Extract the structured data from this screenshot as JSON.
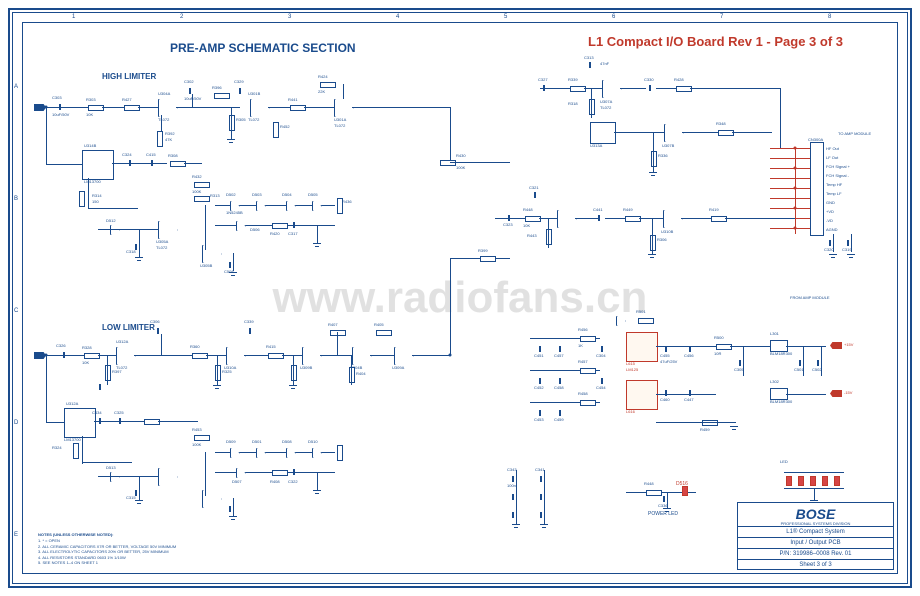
{
  "header": {
    "title": "L1 Compact I/O Board Rev 1 - Page 3 of 3",
    "section_main": "PRE-AMP SCHEMATIC SECTION",
    "section_high": "HIGH LIMITER",
    "section_low": "LOW LIMITER",
    "to_amp": "TO AMP MODULE",
    "from_amp": "FROM AMP MODULE",
    "power_led": "POWER LED",
    "watermark": "www.radiofans.cn"
  },
  "titleblock": {
    "brand": "BOSE",
    "brand_sub": "PROFESSIONAL SYSTEMS DIVISION",
    "product": "L1® Compact System",
    "board": "Input / Output PCB",
    "pn": "P/N: 319986–0008 Rev. 01",
    "sheet": "Sheet 3 of 3"
  },
  "grid": {
    "cols": [
      "1",
      "2",
      "3",
      "4",
      "5",
      "6",
      "7",
      "8"
    ],
    "rows": [
      "A",
      "B",
      "C",
      "D",
      "E"
    ]
  },
  "parts": {
    "opamp": "TL072",
    "comparator": "LM13700",
    "thermal": "LM125",
    "sense_ic": "L615",
    "sense_ic2": "L616",
    "u301a": "U301A",
    "u301b": "U301B",
    "u304a": "U304A",
    "u304b": "U304B",
    "u305a": "U305A",
    "u305b": "U305B",
    "u307a": "U307A",
    "u307b": "U307B",
    "u312a": "U312A",
    "u313a": "U313A",
    "u309a": "U309A",
    "u309b": "U309B",
    "u310a": "U310A",
    "u310b": "U310B",
    "u314b": "U314B",
    "r301": "R301",
    "r302": "R302",
    "r303": "R303",
    "r305": "R305",
    "r306": "R306",
    "r308": "R308",
    "r313": "R313",
    "r314": "R314",
    "r318": "R318",
    "r324": "R324",
    "r325": "R325",
    "r326": "R326",
    "r328": "R328",
    "r330": "R330",
    "r332": "R332",
    "r336": "R336",
    "r339": "R339",
    "r348": "R348",
    "r360": "R360",
    "r366": "R366",
    "r392": "R392",
    "r396": "R396",
    "r397": "R397",
    "r398": "R398",
    "r399": "R399",
    "r404": "R404",
    "r405": "R405",
    "r407": "R407",
    "r408": "R408",
    "r415": "R415",
    "r419": "R419",
    "r420": "R420",
    "r422": "R422",
    "r424": "R424",
    "r427": "R427",
    "r428": "R428",
    "r430": "R430",
    "r432": "R432",
    "r436": "R436",
    "r441": "R441",
    "r443": "R443",
    "r448": "R448",
    "r449": "R449",
    "r452": "R452",
    "r453": "R453",
    "r456": "R456",
    "r457": "R457",
    "r458": "R458",
    "r459": "R459",
    "r500": "R500",
    "r501": "R501",
    "c301": "C301",
    "c302": "C302",
    "c303": "C303",
    "c304": "C304",
    "c305": "C305",
    "c306": "C306",
    "c307": "C307",
    "c308": "C308",
    "c309": "C309",
    "c313": "C313",
    "c315": "C315",
    "c317": "C317",
    "c318": "C318",
    "c319": "C319",
    "c320": "C320",
    "c321": "C321",
    "c322": "C322",
    "c323": "C323",
    "c324": "C324",
    "c325": "C325",
    "c326": "C326",
    "c327": "C327",
    "c329": "C329",
    "c330": "C330",
    "c331": "C331",
    "c333": "C333",
    "c336": "C336",
    "c339": "C339",
    "c341": "C341",
    "c343": "C343",
    "c346": "C346",
    "c415": "C415",
    "c424": "C424",
    "c434": "C434",
    "c441": "C441",
    "c447": "C447",
    "c450": "C450",
    "c451": "C451",
    "c452": "C452",
    "c453": "C453",
    "c454": "C454",
    "c455": "C455",
    "c456": "C456",
    "c457": "C457",
    "c458": "C458",
    "c459": "C459",
    "c460": "C460",
    "c500": "C500",
    "c501": "C501",
    "c502": "C502",
    "c503": "C503",
    "c508": "C508",
    "d501": "D501",
    "d502": "D502",
    "d503": "D503",
    "d504": "D504",
    "d505": "D505",
    "d506": "D506",
    "d507": "D507",
    "d508": "D508",
    "d509": "D509",
    "d510": "D510",
    "d512": "D512",
    "d513": "D513",
    "d514": "D514",
    "d515": "D515",
    "d516": "D516",
    "d517": "D517",
    "led_a": "LED",
    "l301": "L301",
    "l302": "L302",
    "cn300a": "CN300A",
    "cn300b": "CN300B",
    "pin1": "1",
    "pin2": "2",
    "pin3": "3",
    "pin4": "4",
    "pin5": "5",
    "pin6": "6",
    "pin7": "7",
    "pin8": "8",
    "pin9": "9",
    "pin10": "10"
  },
  "vals": {
    "v10k": "10K",
    "v100k": "100K",
    "v1k": "1K",
    "v47k": "47K",
    "v22k": "22K",
    "v2k2": "2.2K",
    "v4k7": "4.7K",
    "v220": "220",
    "v470": "470",
    "v150": "150",
    "v47n": "47nF",
    "v100n": "100n",
    "v10u": "10uF/50V",
    "v47u": "47uF/25V",
    "v1n": "1nF",
    "v470n": "470n",
    "v1u": "1uF/25V",
    "v2v7": "2.7V",
    "v5v": "5V",
    "v1n4148": "1N4148",
    "v1n5245": "1N5245B",
    "vblm": "BLM18R300",
    "v15v": "+15V",
    "v_15v": "-15V",
    "v10r": "10R"
  },
  "conn": {
    "hf_out": "HF Out",
    "lf_out": "LF Out",
    "signal_p": "FCH Signal +",
    "signal_n": "FCH Signal -",
    "temp_hf": "Temp HF",
    "temp_lf": "Temp LF",
    "gnd": "GND",
    "vcc": "+VD",
    "vee": "-VD",
    "agnd": "AGND"
  },
  "caparray": {
    "c343": "C343",
    "c341": "C341",
    "v100n": "100n"
  },
  "notes": {
    "title": "NOTES (UNLESS OTHERWISE NOTED):",
    "n1": "1. * = OPEN",
    "n2": "2. ALL CERAMIC CAPACITORS X7R OR BETTER, VOLTAGE 50V MINIMUM",
    "n3": "3. ALL ELECTROLYTIC CAPACITORS 20% OR BETTER, 25V MINIMUM",
    "n4": "4. ALL RESISTORS STANDARD 0603 1% 1/10W",
    "n5": "5. SEE NOTES 1–4 ON SHEET 1"
  }
}
